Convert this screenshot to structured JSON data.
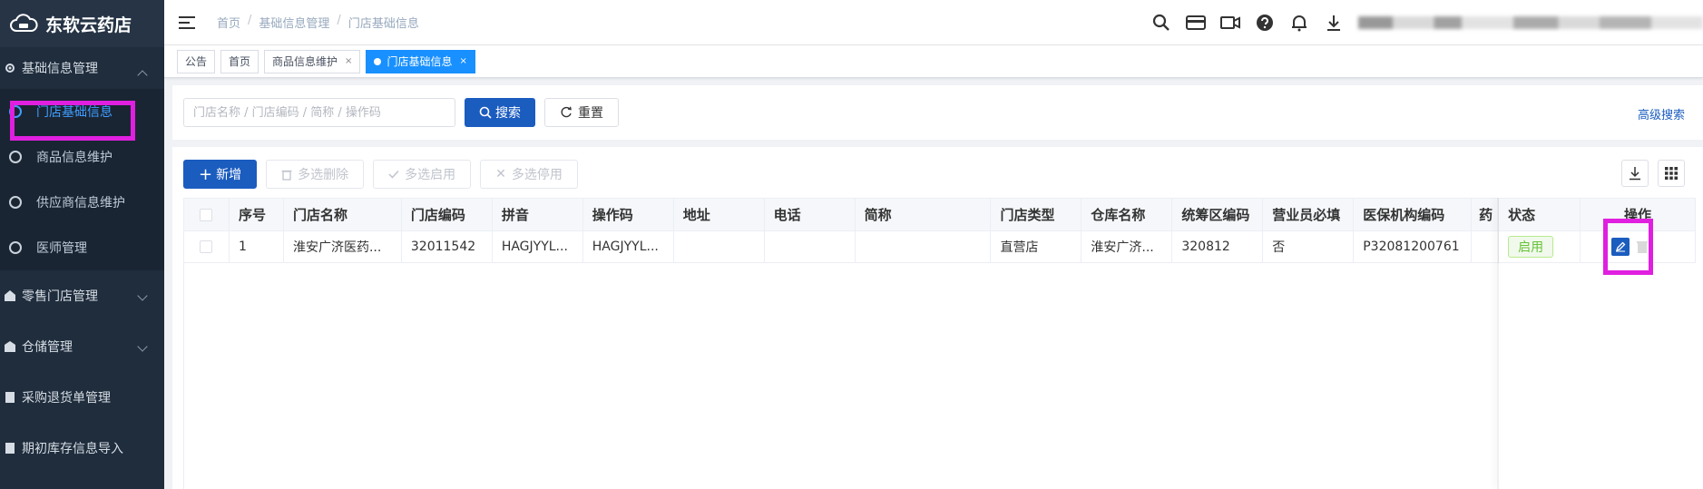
{
  "app": {
    "name": "东软云药店"
  },
  "sidebar": {
    "groups": [
      {
        "label": "基础信息管理",
        "expanded": true,
        "items": [
          {
            "label": "门店基础信息",
            "active": true
          },
          {
            "label": "商品信息维护"
          },
          {
            "label": "供应商信息维护"
          },
          {
            "label": "医师管理"
          }
        ]
      },
      {
        "label": "零售门店管理"
      },
      {
        "label": "仓储管理"
      },
      {
        "label": "采购退货单管理"
      },
      {
        "label": "期初库存信息导入"
      }
    ]
  },
  "breadcrumb": [
    "首页",
    "基础信息管理",
    "门店基础信息"
  ],
  "breadcrumb_sep": "/",
  "tags": [
    {
      "label": "公告"
    },
    {
      "label": "首页"
    },
    {
      "label": "商品信息维护",
      "closable": true
    },
    {
      "label": "门店基础信息",
      "closable": true,
      "active": true
    }
  ],
  "tag_close": "×",
  "search": {
    "placeholder": "门店名称 / 门店编码 / 简称 / 操作码",
    "value": "",
    "search_label": "搜索",
    "reset_label": "重置",
    "advanced_label": "高级搜索"
  },
  "toolbar": {
    "add_label": "新增",
    "batch_delete_label": "多选删除",
    "batch_enable_label": "多选启用",
    "batch_disable_label": "多选停用"
  },
  "table": {
    "columns": [
      "序号",
      "门店名称",
      "门店编码",
      "拼音",
      "操作码",
      "地址",
      "电话",
      "简称",
      "门店类型",
      "仓库名称",
      "统筹区编码",
      "营业员必填",
      "医保机构编码",
      "药",
      "状态",
      "操作"
    ],
    "rows": [
      [
        "1",
        "淮安广济医药...",
        "32011542",
        "HAGJYYL...",
        "HAGJYYL...",
        "",
        "",
        "",
        "直营店",
        "淮安广济...",
        "320812",
        "否",
        "P32081200761",
        "",
        "启用",
        ""
      ]
    ]
  },
  "colors": {
    "sidebar_bg": "#1f2d3d",
    "primary": "#1b5cbf",
    "active_tag": "#1890ff",
    "highlight": "#e01fe0",
    "status_green": "#67c23a"
  }
}
